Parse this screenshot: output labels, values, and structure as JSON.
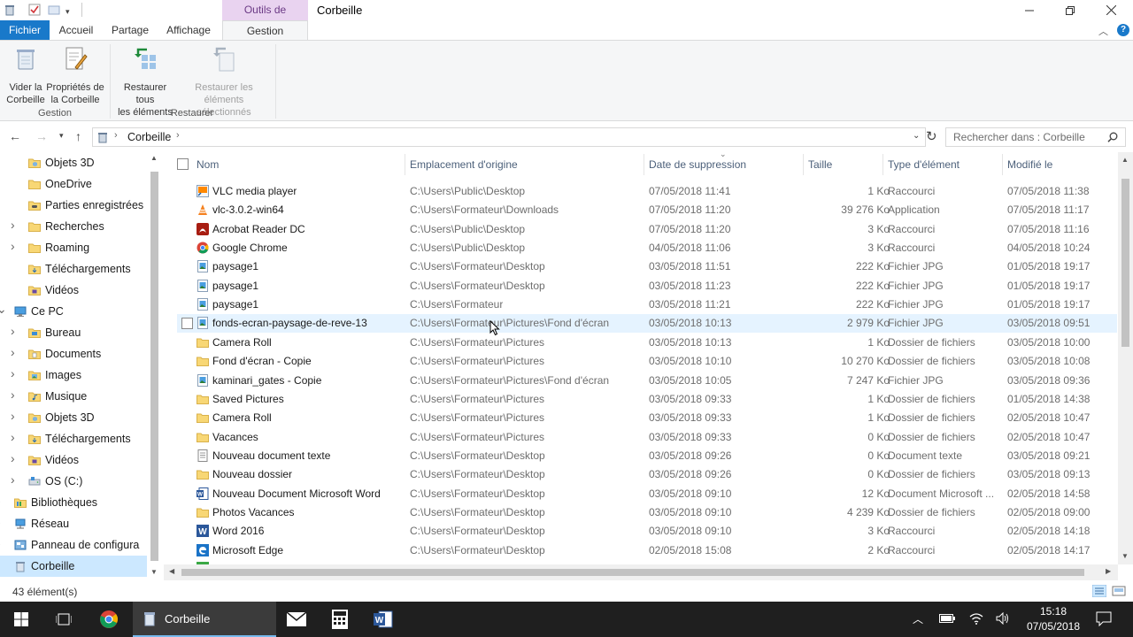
{
  "window": {
    "title": "Corbeille",
    "context_tab_header": "Outils de Corbeille"
  },
  "ribbon_tabs": [
    "Fichier",
    "Accueil",
    "Partage",
    "Affichage",
    "Gestion"
  ],
  "ribbon": {
    "empty_bin": "Vider la\nCorbeille",
    "bin_properties": "Propriétés de\nla Corbeille",
    "group_gestion": "Gestion",
    "restore_all": "Restaurer tous\nles éléments",
    "restore_selected": "Restaurer les\néléments sélectionnés",
    "group_restaurer": "Restaurer"
  },
  "address": {
    "path": "Corbeille",
    "search_placeholder": "Rechercher dans : Corbeille"
  },
  "nav_items": [
    {
      "label": "Objets 3D",
      "icon": "3d-objects-folder-icon",
      "indent": 1,
      "expand": ""
    },
    {
      "label": "OneDrive",
      "icon": "folder-icon",
      "indent": 1,
      "expand": ""
    },
    {
      "label": "Parties enregistrées",
      "icon": "saved-games-icon",
      "indent": 1,
      "expand": ""
    },
    {
      "label": "Recherches",
      "icon": "folder-icon",
      "indent": 1,
      "expand": ">"
    },
    {
      "label": "Roaming",
      "icon": "folder-icon",
      "indent": 1,
      "expand": ">"
    },
    {
      "label": "Téléchargements",
      "icon": "downloads-folder-icon",
      "indent": 1,
      "expand": ""
    },
    {
      "label": "Vidéos",
      "icon": "videos-folder-icon",
      "indent": 1,
      "expand": ""
    },
    {
      "label": "Ce PC",
      "icon": "computer-icon",
      "indent": 0,
      "expand": "v"
    },
    {
      "label": "Bureau",
      "icon": "desktop-folder-icon",
      "indent": 1,
      "expand": ">"
    },
    {
      "label": "Documents",
      "icon": "documents-folder-icon",
      "indent": 1,
      "expand": ">"
    },
    {
      "label": "Images",
      "icon": "pictures-folder-icon",
      "indent": 1,
      "expand": ">"
    },
    {
      "label": "Musique",
      "icon": "music-folder-icon",
      "indent": 1,
      "expand": ">"
    },
    {
      "label": "Objets 3D",
      "icon": "3d-objects-folder-icon",
      "indent": 1,
      "expand": ">"
    },
    {
      "label": "Téléchargements",
      "icon": "downloads-folder-icon",
      "indent": 1,
      "expand": ">"
    },
    {
      "label": "Vidéos",
      "icon": "videos-folder-icon",
      "indent": 1,
      "expand": ">"
    },
    {
      "label": "OS (C:)",
      "icon": "drive-icon",
      "indent": 1,
      "expand": ">"
    },
    {
      "label": "Bibliothèques",
      "icon": "libraries-icon",
      "indent": 0,
      "expand": ">"
    },
    {
      "label": "Réseau",
      "icon": "network-icon",
      "indent": 0,
      "expand": ">"
    },
    {
      "label": "Panneau de configura",
      "icon": "control-panel-icon",
      "indent": 0,
      "expand": ">"
    },
    {
      "label": "Corbeille",
      "icon": "recycle-bin-icon",
      "indent": 0,
      "expand": "",
      "selected": true
    }
  ],
  "columns": {
    "name": "Nom",
    "origin": "Emplacement d'origine",
    "deleted": "Date de suppression",
    "size": "Taille",
    "type": "Type d'élément",
    "modified": "Modifié le"
  },
  "files": [
    {
      "name": "VLC media player",
      "icon": "shortcut-icon",
      "origin": "C:\\Users\\Public\\Desktop",
      "deleted": "07/05/2018 11:41",
      "size": "1 Ko",
      "type": "Raccourci",
      "modified": "07/05/2018 11:38"
    },
    {
      "name": "vlc-3.0.2-win64",
      "icon": "vlc-icon",
      "origin": "C:\\Users\\Formateur\\Downloads",
      "deleted": "07/05/2018 11:20",
      "size": "39 276 Ko",
      "type": "Application",
      "modified": "07/05/2018 11:17"
    },
    {
      "name": "Acrobat Reader DC",
      "icon": "acrobat-icon",
      "origin": "C:\\Users\\Public\\Desktop",
      "deleted": "07/05/2018 11:20",
      "size": "3 Ko",
      "type": "Raccourci",
      "modified": "07/05/2018 11:16"
    },
    {
      "name": "Google Chrome",
      "icon": "chrome-icon",
      "origin": "C:\\Users\\Public\\Desktop",
      "deleted": "04/05/2018 11:06",
      "size": "3 Ko",
      "type": "Raccourci",
      "modified": "04/05/2018 10:24"
    },
    {
      "name": "paysage1",
      "icon": "image-file-icon",
      "origin": "C:\\Users\\Formateur\\Desktop",
      "deleted": "03/05/2018 11:51",
      "size": "222 Ko",
      "type": "Fichier JPG",
      "modified": "01/05/2018 19:17"
    },
    {
      "name": "paysage1",
      "icon": "image-file-icon",
      "origin": "C:\\Users\\Formateur\\Desktop",
      "deleted": "03/05/2018 11:23",
      "size": "222 Ko",
      "type": "Fichier JPG",
      "modified": "01/05/2018 19:17"
    },
    {
      "name": "paysage1",
      "icon": "image-file-icon",
      "origin": "C:\\Users\\Formateur",
      "deleted": "03/05/2018 11:21",
      "size": "222 Ko",
      "type": "Fichier JPG",
      "modified": "01/05/2018 19:17"
    },
    {
      "name": "fonds-ecran-paysage-de-reve-13",
      "icon": "image-file-icon",
      "origin": "C:\\Users\\Formateur\\Pictures\\Fond d'écran",
      "deleted": "03/05/2018 10:13",
      "size": "2 979 Ko",
      "type": "Fichier JPG",
      "modified": "03/05/2018 09:51",
      "hover": true
    },
    {
      "name": "Camera Roll",
      "icon": "folder-icon",
      "origin": "C:\\Users\\Formateur\\Pictures",
      "deleted": "03/05/2018 10:13",
      "size": "1 Ko",
      "type": "Dossier de fichiers",
      "modified": "03/05/2018 10:00"
    },
    {
      "name": "Fond d'écran - Copie",
      "icon": "folder-icon",
      "origin": "C:\\Users\\Formateur\\Pictures",
      "deleted": "03/05/2018 10:10",
      "size": "10 270 Ko",
      "type": "Dossier de fichiers",
      "modified": "03/05/2018 10:08"
    },
    {
      "name": "kaminari_gates - Copie",
      "icon": "image-file-icon",
      "origin": "C:\\Users\\Formateur\\Pictures\\Fond d'écran",
      "deleted": "03/05/2018 10:05",
      "size": "7 247 Ko",
      "type": "Fichier JPG",
      "modified": "03/05/2018 09:36"
    },
    {
      "name": "Saved Pictures",
      "icon": "folder-icon",
      "origin": "C:\\Users\\Formateur\\Pictures",
      "deleted": "03/05/2018 09:33",
      "size": "1 Ko",
      "type": "Dossier de fichiers",
      "modified": "01/05/2018 14:38"
    },
    {
      "name": "Camera Roll",
      "icon": "folder-icon",
      "origin": "C:\\Users\\Formateur\\Pictures",
      "deleted": "03/05/2018 09:33",
      "size": "1 Ko",
      "type": "Dossier de fichiers",
      "modified": "02/05/2018 10:47"
    },
    {
      "name": "Vacances",
      "icon": "folder-icon",
      "origin": "C:\\Users\\Formateur\\Pictures",
      "deleted": "03/05/2018 09:33",
      "size": "0 Ko",
      "type": "Dossier de fichiers",
      "modified": "02/05/2018 10:47"
    },
    {
      "name": "Nouveau document texte",
      "icon": "text-file-icon",
      "origin": "C:\\Users\\Formateur\\Desktop",
      "deleted": "03/05/2018 09:26",
      "size": "0 Ko",
      "type": "Document texte",
      "modified": "03/05/2018 09:21"
    },
    {
      "name": "Nouveau dossier",
      "icon": "folder-icon",
      "origin": "C:\\Users\\Formateur\\Desktop",
      "deleted": "03/05/2018 09:26",
      "size": "0 Ko",
      "type": "Dossier de fichiers",
      "modified": "03/05/2018 09:13"
    },
    {
      "name": "Nouveau Document Microsoft Word",
      "icon": "word-doc-icon",
      "origin": "C:\\Users\\Formateur\\Desktop",
      "deleted": "03/05/2018 09:10",
      "size": "12 Ko",
      "type": "Document Microsoft ...",
      "modified": "02/05/2018 14:58"
    },
    {
      "name": "Photos Vacances",
      "icon": "folder-icon",
      "origin": "C:\\Users\\Formateur\\Desktop",
      "deleted": "03/05/2018 09:10",
      "size": "4 239 Ko",
      "type": "Dossier de fichiers",
      "modified": "02/05/2018 09:00"
    },
    {
      "name": "Word 2016",
      "icon": "word-app-icon",
      "origin": "C:\\Users\\Formateur\\Desktop",
      "deleted": "03/05/2018 09:10",
      "size": "3 Ko",
      "type": "Raccourci",
      "modified": "02/05/2018 14:18"
    },
    {
      "name": "Microsoft Edge",
      "icon": "edge-icon",
      "origin": "C:\\Users\\Formateur\\Desktop",
      "deleted": "02/05/2018 15:08",
      "size": "2 Ko",
      "type": "Raccourci",
      "modified": "02/05/2018 14:17"
    }
  ],
  "status": {
    "count": "43 élément(s)"
  },
  "taskbar": {
    "explorer_label": "Corbeille",
    "time": "15:18",
    "date": "07/05/2018"
  },
  "colors": {
    "accent": "#1979ca",
    "context_tab": "#e9d3f0",
    "selection": "#cce8ff",
    "hover": "#e5f3ff",
    "folder": "#f8d775",
    "taskbar": "#1f1f1f"
  }
}
